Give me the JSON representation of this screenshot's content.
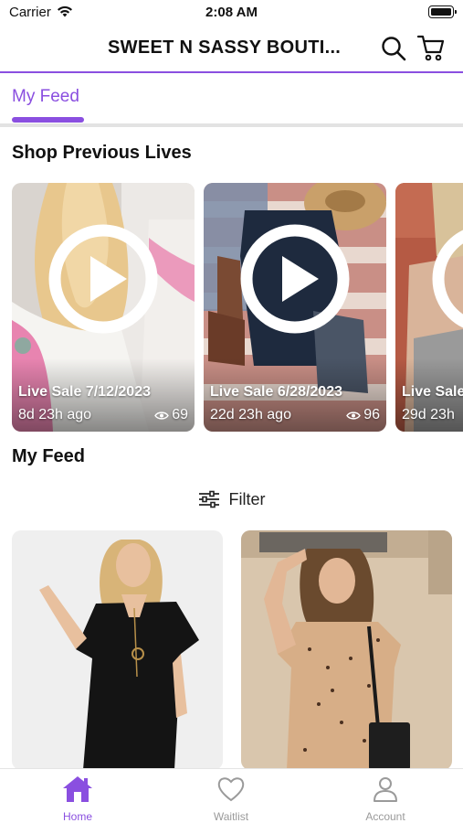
{
  "status_bar": {
    "carrier": "Carrier",
    "time": "2:08 AM"
  },
  "header": {
    "store_name": "SWEET N SASSY BOUTI...",
    "icons": [
      "search-icon",
      "cart-icon"
    ]
  },
  "tabs": [
    {
      "label": "My Feed",
      "active": true
    }
  ],
  "colors": {
    "accent": "#8a4fe0",
    "inactive": "#9a9a9a"
  },
  "previous_lives": {
    "heading": "Shop Previous Lives",
    "items": [
      {
        "title": "Live Sale 7/12/2023",
        "ago": "8d 23h ago",
        "views": "69"
      },
      {
        "title": "Live Sale 6/28/2023",
        "ago": "22d 23h ago",
        "views": "96"
      },
      {
        "title": "Live Sale",
        "ago": "29d 23h",
        "views": ""
      }
    ]
  },
  "feed": {
    "heading": "My Feed",
    "filter_label": "Filter"
  },
  "bottom_nav": [
    {
      "label": "Home",
      "icon": "home-icon",
      "active": true
    },
    {
      "label": "Waitlist",
      "icon": "heart-icon",
      "active": false
    },
    {
      "label": "Account",
      "icon": "account-icon",
      "active": false
    }
  ]
}
